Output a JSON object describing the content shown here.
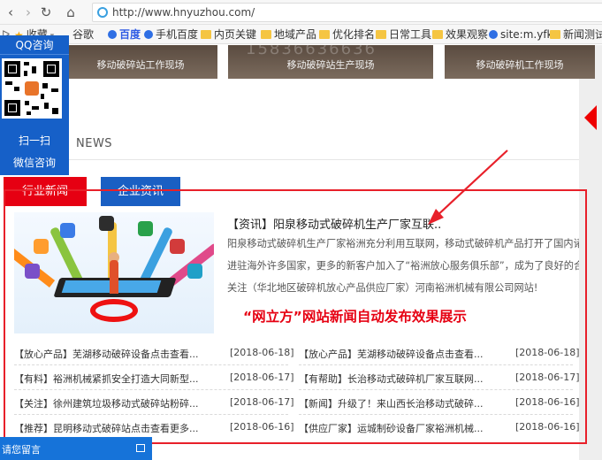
{
  "browser": {
    "url": "http://www.hnyuzhou.com/",
    "bookmarks": [
      {
        "label": "收藏",
        "icon": "star-icon"
      },
      {
        "label": "谷歌",
        "icon": "page-icon"
      },
      {
        "label": "百度",
        "icon": "baidu-paw-icon"
      },
      {
        "label": "手机百度",
        "icon": "baidu-paw-icon"
      },
      {
        "label": "内页关键",
        "icon": "folder-icon"
      },
      {
        "label": "地域产品",
        "icon": "folder-icon"
      },
      {
        "label": "优化排名",
        "icon": "folder-icon"
      },
      {
        "label": "日常工具",
        "icon": "folder-icon"
      },
      {
        "label": "效果观察",
        "icon": "folder-icon"
      },
      {
        "label": "site:m.yfk",
        "icon": "baidu-paw-icon"
      },
      {
        "label": "新闻测试",
        "icon": "folder-icon"
      }
    ]
  },
  "gallery": {
    "captions": [
      "移动破碎站工作现场",
      "移动破碎站生产现场",
      "移动破碎机工作现场"
    ],
    "watermark": "15836636636"
  },
  "qq_panel": {
    "title": "QQ咨询",
    "scan_label": "扫一扫",
    "wechat_label": "微信咨询"
  },
  "news": {
    "section_title": "NEWS",
    "tabs": [
      "行业新闻",
      "企业资讯"
    ],
    "headline": "【资讯】阳泉移动式破碎机生产厂家互联..",
    "summary_lines": [
      "阳泉移动式破碎机生产厂家裕洲充分利用互联网，移动式破碎机产品打开了国内诸多省",
      "进驻海外许多国家，更多的新客户加入了“裕洲放心服务俱乐部”，成为了良好的合作",
      "关注（华北地区破碎机放心产品供应厂家）河南裕洲机械有限公司网站!"
    ],
    "promo": "“网立方”网站新闻自动发布效果展示",
    "list_left": [
      {
        "title": "【放心产品】芜湖移动破碎设备点击查看...",
        "date": "[2018-06-18]"
      },
      {
        "title": "【有料】裕洲机械紧抓安全打造大同新型...",
        "date": "[2018-06-17]"
      },
      {
        "title": "【关注】徐州建筑垃圾移动式破碎站粉碎...",
        "date": "[2018-06-17]"
      },
      {
        "title": "【推荐】昆明移动式破碎站点击查看更多...",
        "date": "[2018-06-16]"
      }
    ],
    "list_right": [
      {
        "title": "【放心产品】芜湖移动破碎设备点击查看...",
        "date": "[2018-06-18]"
      },
      {
        "title": "【有帮助】长治移动式破碎机厂家互联网...",
        "date": "[2018-06-17]"
      },
      {
        "title": "【新闻】升级了！来山西长治移动式破碎...",
        "date": "[2018-06-16]"
      },
      {
        "title": "【供应厂家】运城制砂设备厂家裕洲机械...",
        "date": "[2018-06-16]"
      }
    ]
  },
  "message_bar": {
    "label": "请您留言"
  },
  "colors": {
    "accent_red": "#e60012",
    "accent_blue": "#1a5fc3",
    "annotation_red": "#e8202a"
  }
}
